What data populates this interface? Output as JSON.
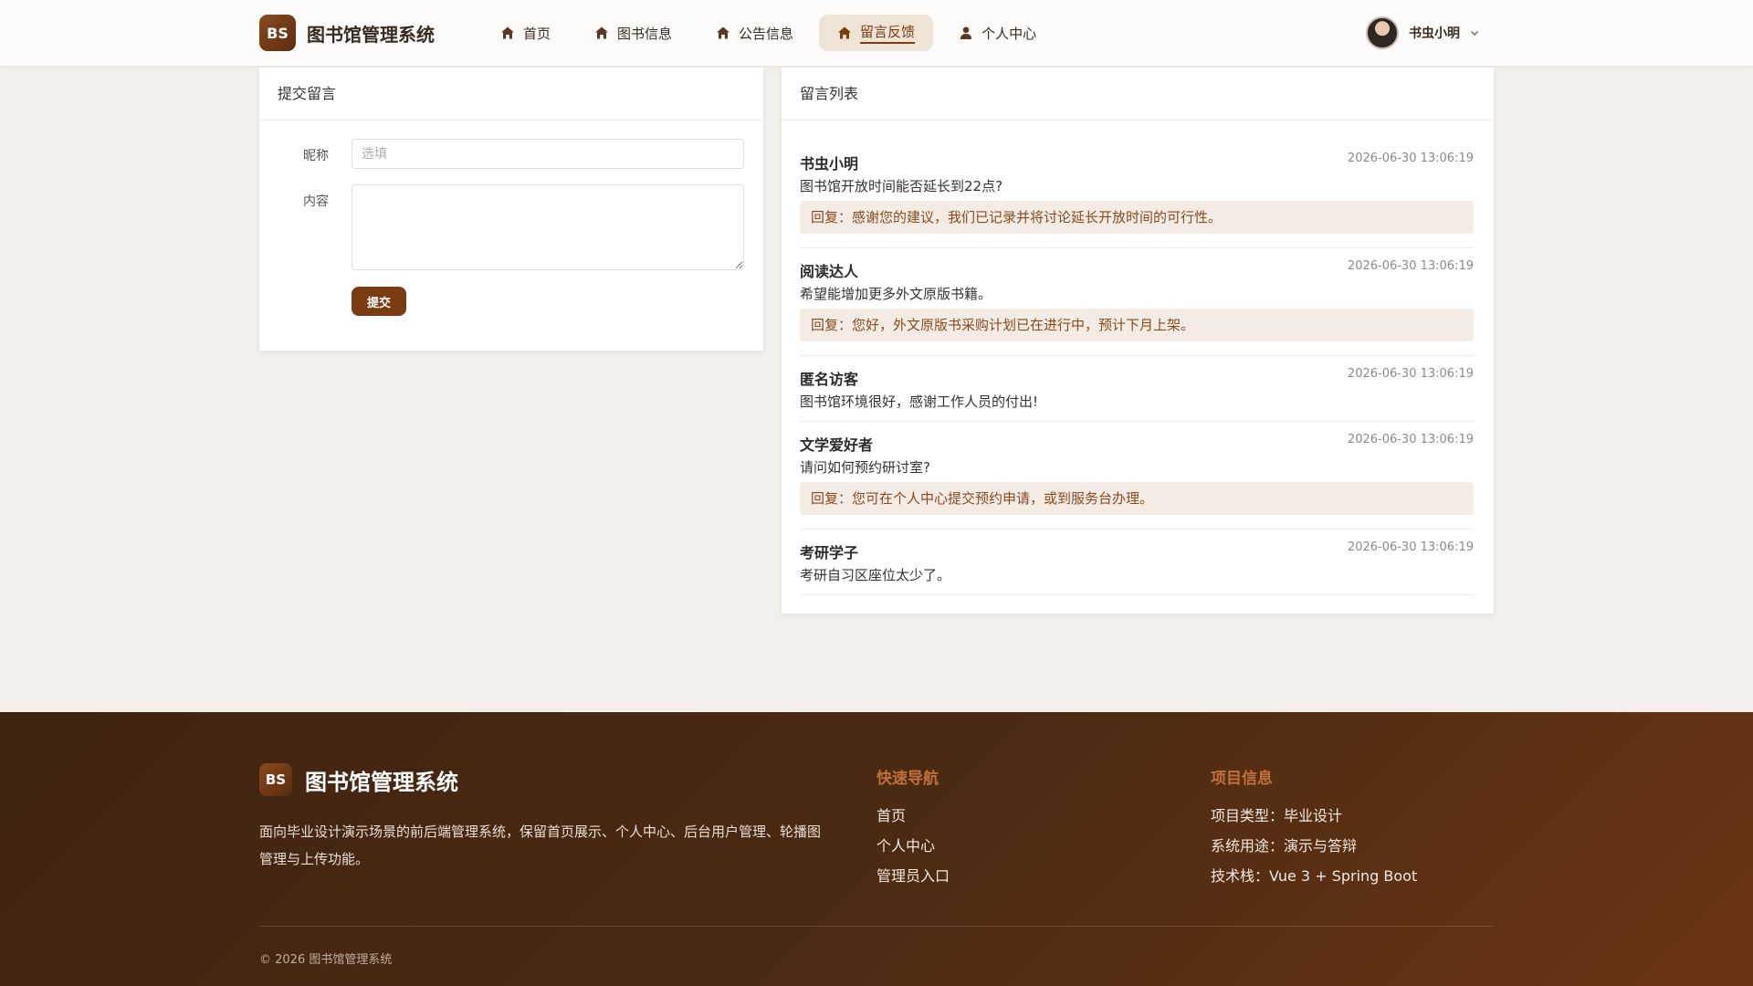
{
  "header": {
    "logo_badge": "BS",
    "app_title": "图书馆管理系统",
    "nav": [
      {
        "label": "首页",
        "icon": "home-icon"
      },
      {
        "label": "图书信息",
        "icon": "home-icon"
      },
      {
        "label": "公告信息",
        "icon": "home-icon"
      },
      {
        "label": "留言反馈",
        "icon": "home-icon",
        "active": true
      },
      {
        "label": "个人中心",
        "icon": "user-icon"
      }
    ],
    "user_name": "书虫小明"
  },
  "submit_form": {
    "title": "提交留言",
    "nickname_label": "昵称",
    "nickname_placeholder": "选填",
    "content_label": "内容",
    "submit_label": "提交"
  },
  "message_list": {
    "title": "留言列表",
    "items": [
      {
        "name": "书虫小明",
        "time": "2026-06-30 13:06:19",
        "content": "图书馆开放时间能否延长到22点?",
        "reply": "回复：感谢您的建议，我们已记录并将讨论延长开放时间的可行性。"
      },
      {
        "name": "阅读达人",
        "time": "2026-06-30 13:06:19",
        "content": "希望能增加更多外文原版书籍。",
        "reply": "回复：您好，外文原版书采购计划已在进行中，预计下月上架。"
      },
      {
        "name": "匿名访客",
        "time": "2026-06-30 13:06:19",
        "content": "图书馆环境很好，感谢工作人员的付出!",
        "reply": ""
      },
      {
        "name": "文学爱好者",
        "time": "2026-06-30 13:06:19",
        "content": "请问如何预约研讨室?",
        "reply": "回复：您可在个人中心提交预约申请，或到服务台办理。"
      },
      {
        "name": "考研学子",
        "time": "2026-06-30 13:06:19",
        "content": "考研自习区座位太少了。",
        "reply": ""
      }
    ]
  },
  "footer": {
    "logo_badge": "BS",
    "title": "图书馆管理系统",
    "description": "面向毕业设计演示场景的前后端管理系统，保留首页展示、个人中心、后台用户管理、轮播图管理与上传功能。",
    "quick_nav_title": "快速导航",
    "quick_nav": [
      "首页",
      "个人中心",
      "管理员入口"
    ],
    "project_info_title": "项目信息",
    "project_info": [
      "项目类型：毕业设计",
      "系统用途：演示与答辩",
      "技术栈：Vue 3 + Spring Boot"
    ],
    "copyright": "© 2026 图书馆管理系统"
  },
  "colors": {
    "accent": "#7a3d12",
    "active_nav_bg": "#efe3d6",
    "reply_bg": "#f3ebe4",
    "footer_heading": "#c0703a"
  }
}
